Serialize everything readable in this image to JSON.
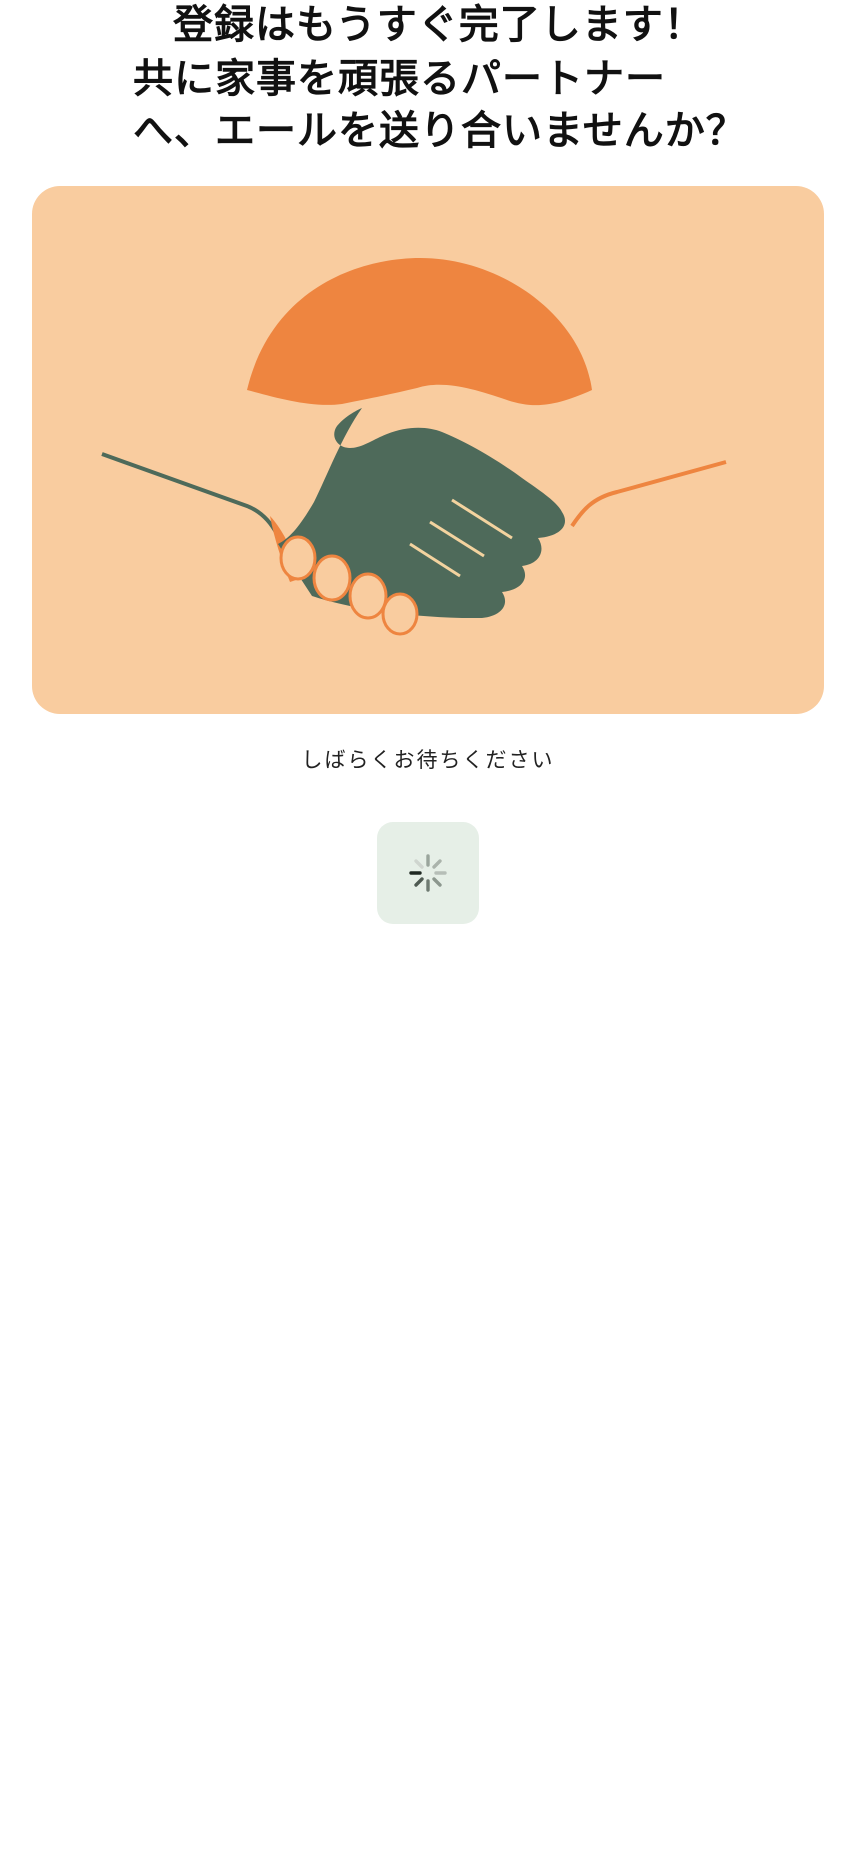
{
  "heading": {
    "line1": "登録はもうすぐ完了します！",
    "line2": "共に家事を頑張るパートナー",
    "line3": "へ、エールを送り合いませんか？"
  },
  "illustration": {
    "icon": "handshake-illustration",
    "background_color": "#f9cc9f",
    "colors": {
      "orange": "#ee8540",
      "green": "#4e6a5a",
      "cream": "#f9cc9f"
    }
  },
  "status": {
    "text": "しばらくお待ちください"
  },
  "spinner": {
    "icon": "loading-spinner-icon",
    "background_color": "#e6efe7"
  }
}
